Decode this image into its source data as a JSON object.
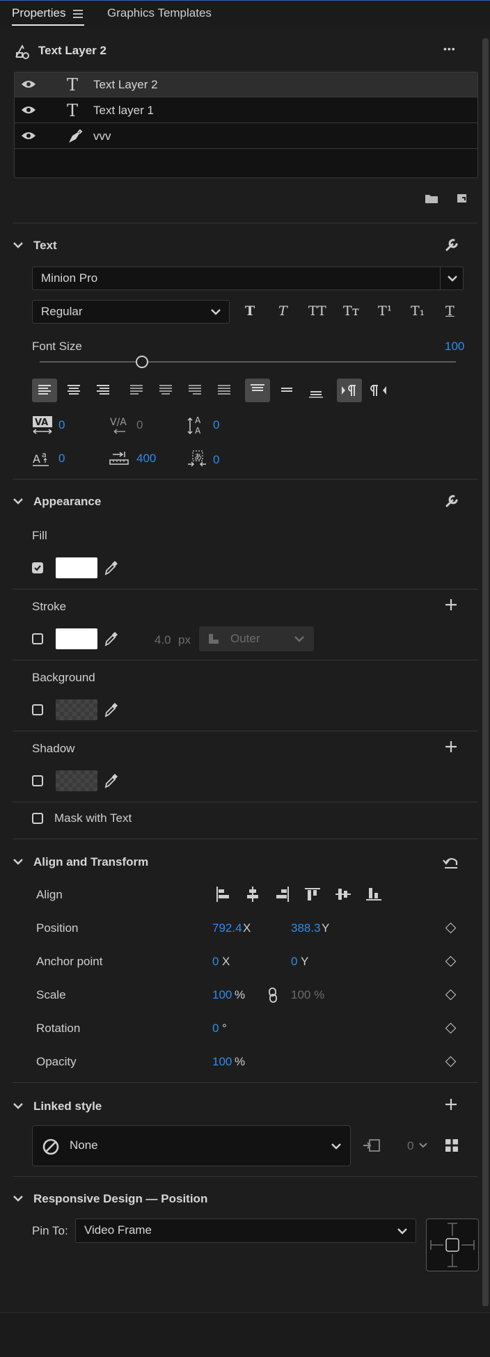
{
  "tabs": [
    {
      "label": "Properties",
      "active": true
    },
    {
      "label": "Graphics Templates",
      "active": false
    }
  ],
  "header": {
    "title": "Text Layer 2",
    "more_label": "•••"
  },
  "layers": [
    {
      "name": "Text Layer 2",
      "type": "text",
      "selected": true
    },
    {
      "name": "Text layer 1",
      "type": "text",
      "selected": false
    },
    {
      "name": "vvv",
      "type": "shape",
      "selected": false
    }
  ],
  "text_section": {
    "title": "Text",
    "font_family": "Minion Pro",
    "font_style": "Regular",
    "font_size_label": "Font Size",
    "font_size_value": "100",
    "font_size_slider_fraction": 0.25,
    "style_buttons": [
      "T",
      "T",
      "TT",
      "Tт",
      "T¹",
      "T₁",
      "T"
    ],
    "kerning": "0",
    "tracking": "0",
    "leading": "0",
    "baseline": "0",
    "tab_width": "400",
    "tsume": "0"
  },
  "appearance": {
    "title": "Appearance",
    "fill_label": "Fill",
    "fill_checked": true,
    "fill_color": "#ffffff",
    "stroke_label": "Stroke",
    "stroke_checked": false,
    "stroke_color": "#ffffff",
    "stroke_width": "4.0",
    "stroke_unit": "px",
    "stroke_type": "Outer",
    "background_label": "Background",
    "background_checked": false,
    "shadow_label": "Shadow",
    "shadow_checked": false,
    "mask_label": "Mask with Text",
    "mask_checked": false
  },
  "align_transform": {
    "title": "Align and Transform",
    "align_label": "Align",
    "position_label": "Position",
    "position_x": "792.4",
    "position_y": "388.3",
    "anchor_label": "Anchor point",
    "anchor_x": "0",
    "anchor_y": "0",
    "scale_label": "Scale",
    "scale_value": "100",
    "scale_unit": "%",
    "scale_linked_value": "100 %",
    "rotation_label": "Rotation",
    "rotation_value": "0",
    "rotation_unit": "°",
    "opacity_label": "Opacity",
    "opacity_value": "100",
    "opacity_unit": "%",
    "x_suffix": "X",
    "y_suffix": "Y"
  },
  "linked_style": {
    "title": "Linked style",
    "style_value": "None",
    "count": "0"
  },
  "responsive": {
    "title": "Responsive Design — Position",
    "pin_label": "Pin To:",
    "pin_value": "Video Frame"
  },
  "colors": {
    "accent": "#2d8ceb",
    "background": "#1d1d1d",
    "input_bg": "#121212"
  }
}
